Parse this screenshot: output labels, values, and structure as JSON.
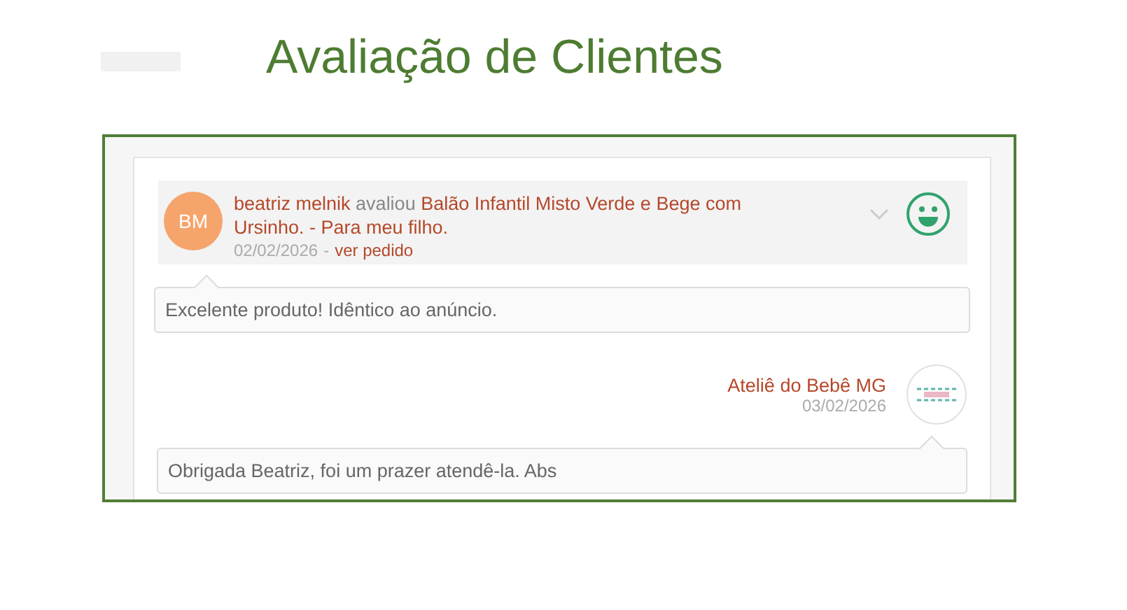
{
  "page_title": "Avaliação de Clientes",
  "review": {
    "initials": "BM",
    "author": "beatriz melnik",
    "verb": "avaliou",
    "product": "Balão Infantil Misto Verde e Bege com Ursinho. - Para meu filho.",
    "date": "02/02/2026",
    "separator": "-",
    "order_link": "ver pedido",
    "comment": "Excelente produto! Idêntico ao anúncio.",
    "expanded": false
  },
  "reply": {
    "store": "Ateliê do Bebê MG",
    "date": "03/02/2026",
    "text": "Obrigada Beatriz, foi um prazer atendê-la. Abs"
  }
}
